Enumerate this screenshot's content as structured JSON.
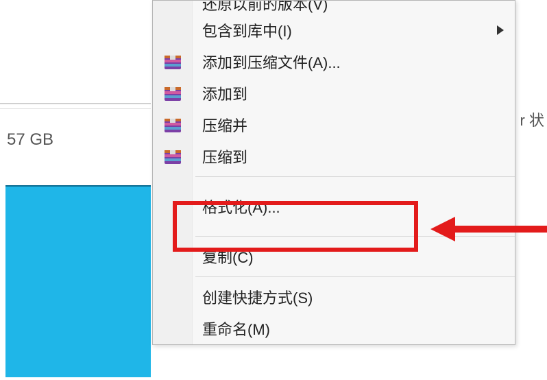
{
  "partial_labels": {
    "disk_size": "57 GB",
    "right_status": "r 状"
  },
  "menu": {
    "items": [
      {
        "label": "还原以前的版本(V)",
        "icon": null,
        "submenu": false,
        "partial": true
      },
      {
        "label": "包含到库中(I)",
        "icon": null,
        "submenu": true
      },
      {
        "label": "添加到压缩文件(A)...",
        "icon": "rar-icon",
        "submenu": false
      },
      {
        "label": "添加到",
        "icon": "rar-icon",
        "submenu": false
      },
      {
        "label": "压缩并",
        "icon": "rar-icon",
        "submenu": false
      },
      {
        "label": "压缩到",
        "icon": "rar-icon",
        "submenu": false
      }
    ],
    "separator1": true,
    "format_label": "格式化(A)...",
    "separator2": true,
    "copy_label": "复制(C)",
    "separator3": true,
    "shortcut_label": "创建快捷方式(S)",
    "rename_label": "重命名(M)"
  }
}
